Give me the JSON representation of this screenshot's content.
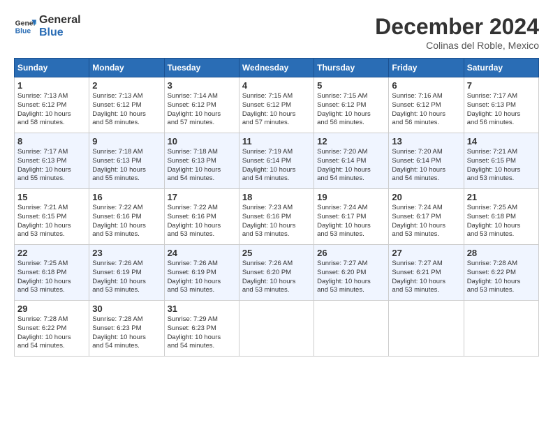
{
  "header": {
    "logo_line1": "General",
    "logo_line2": "Blue",
    "month_title": "December 2024",
    "location": "Colinas del Roble, Mexico"
  },
  "days_of_week": [
    "Sunday",
    "Monday",
    "Tuesday",
    "Wednesday",
    "Thursday",
    "Friday",
    "Saturday"
  ],
  "weeks": [
    [
      {
        "day": "1",
        "info": "Sunrise: 7:13 AM\nSunset: 6:12 PM\nDaylight: 10 hours\nand 58 minutes."
      },
      {
        "day": "2",
        "info": "Sunrise: 7:13 AM\nSunset: 6:12 PM\nDaylight: 10 hours\nand 58 minutes."
      },
      {
        "day": "3",
        "info": "Sunrise: 7:14 AM\nSunset: 6:12 PM\nDaylight: 10 hours\nand 57 minutes."
      },
      {
        "day": "4",
        "info": "Sunrise: 7:15 AM\nSunset: 6:12 PM\nDaylight: 10 hours\nand 57 minutes."
      },
      {
        "day": "5",
        "info": "Sunrise: 7:15 AM\nSunset: 6:12 PM\nDaylight: 10 hours\nand 56 minutes."
      },
      {
        "day": "6",
        "info": "Sunrise: 7:16 AM\nSunset: 6:12 PM\nDaylight: 10 hours\nand 56 minutes."
      },
      {
        "day": "7",
        "info": "Sunrise: 7:17 AM\nSunset: 6:13 PM\nDaylight: 10 hours\nand 56 minutes."
      }
    ],
    [
      {
        "day": "8",
        "info": "Sunrise: 7:17 AM\nSunset: 6:13 PM\nDaylight: 10 hours\nand 55 minutes."
      },
      {
        "day": "9",
        "info": "Sunrise: 7:18 AM\nSunset: 6:13 PM\nDaylight: 10 hours\nand 55 minutes."
      },
      {
        "day": "10",
        "info": "Sunrise: 7:18 AM\nSunset: 6:13 PM\nDaylight: 10 hours\nand 54 minutes."
      },
      {
        "day": "11",
        "info": "Sunrise: 7:19 AM\nSunset: 6:14 PM\nDaylight: 10 hours\nand 54 minutes."
      },
      {
        "day": "12",
        "info": "Sunrise: 7:20 AM\nSunset: 6:14 PM\nDaylight: 10 hours\nand 54 minutes."
      },
      {
        "day": "13",
        "info": "Sunrise: 7:20 AM\nSunset: 6:14 PM\nDaylight: 10 hours\nand 54 minutes."
      },
      {
        "day": "14",
        "info": "Sunrise: 7:21 AM\nSunset: 6:15 PM\nDaylight: 10 hours\nand 53 minutes."
      }
    ],
    [
      {
        "day": "15",
        "info": "Sunrise: 7:21 AM\nSunset: 6:15 PM\nDaylight: 10 hours\nand 53 minutes."
      },
      {
        "day": "16",
        "info": "Sunrise: 7:22 AM\nSunset: 6:16 PM\nDaylight: 10 hours\nand 53 minutes."
      },
      {
        "day": "17",
        "info": "Sunrise: 7:22 AM\nSunset: 6:16 PM\nDaylight: 10 hours\nand 53 minutes."
      },
      {
        "day": "18",
        "info": "Sunrise: 7:23 AM\nSunset: 6:16 PM\nDaylight: 10 hours\nand 53 minutes."
      },
      {
        "day": "19",
        "info": "Sunrise: 7:24 AM\nSunset: 6:17 PM\nDaylight: 10 hours\nand 53 minutes."
      },
      {
        "day": "20",
        "info": "Sunrise: 7:24 AM\nSunset: 6:17 PM\nDaylight: 10 hours\nand 53 minutes."
      },
      {
        "day": "21",
        "info": "Sunrise: 7:25 AM\nSunset: 6:18 PM\nDaylight: 10 hours\nand 53 minutes."
      }
    ],
    [
      {
        "day": "22",
        "info": "Sunrise: 7:25 AM\nSunset: 6:18 PM\nDaylight: 10 hours\nand 53 minutes."
      },
      {
        "day": "23",
        "info": "Sunrise: 7:26 AM\nSunset: 6:19 PM\nDaylight: 10 hours\nand 53 minutes."
      },
      {
        "day": "24",
        "info": "Sunrise: 7:26 AM\nSunset: 6:19 PM\nDaylight: 10 hours\nand 53 minutes."
      },
      {
        "day": "25",
        "info": "Sunrise: 7:26 AM\nSunset: 6:20 PM\nDaylight: 10 hours\nand 53 minutes."
      },
      {
        "day": "26",
        "info": "Sunrise: 7:27 AM\nSunset: 6:20 PM\nDaylight: 10 hours\nand 53 minutes."
      },
      {
        "day": "27",
        "info": "Sunrise: 7:27 AM\nSunset: 6:21 PM\nDaylight: 10 hours\nand 53 minutes."
      },
      {
        "day": "28",
        "info": "Sunrise: 7:28 AM\nSunset: 6:22 PM\nDaylight: 10 hours\nand 53 minutes."
      }
    ],
    [
      {
        "day": "29",
        "info": "Sunrise: 7:28 AM\nSunset: 6:22 PM\nDaylight: 10 hours\nand 54 minutes."
      },
      {
        "day": "30",
        "info": "Sunrise: 7:28 AM\nSunset: 6:23 PM\nDaylight: 10 hours\nand 54 minutes."
      },
      {
        "day": "31",
        "info": "Sunrise: 7:29 AM\nSunset: 6:23 PM\nDaylight: 10 hours\nand 54 minutes."
      },
      {
        "day": "",
        "info": ""
      },
      {
        "day": "",
        "info": ""
      },
      {
        "day": "",
        "info": ""
      },
      {
        "day": "",
        "info": ""
      }
    ]
  ]
}
